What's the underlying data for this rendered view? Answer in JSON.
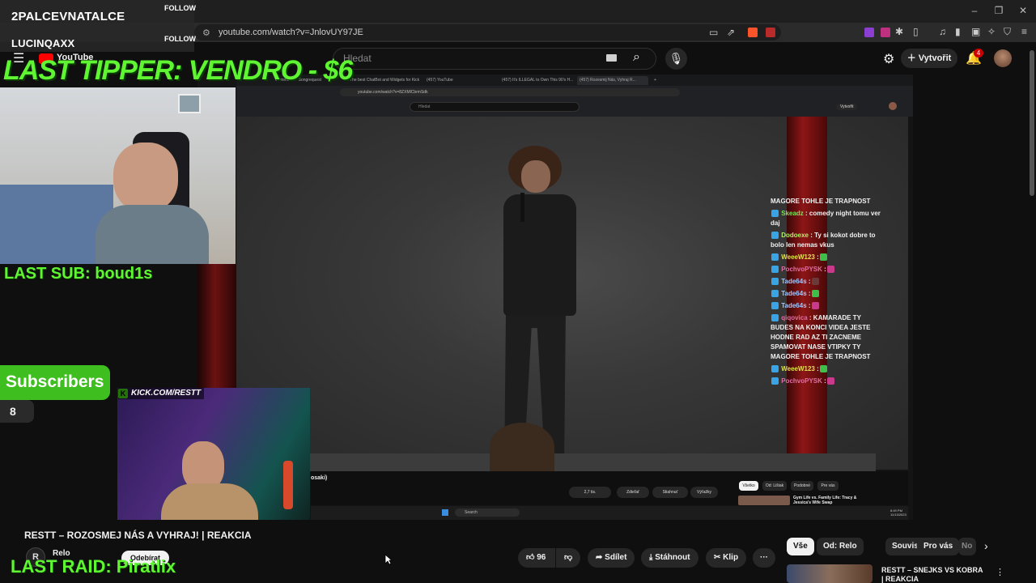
{
  "browser": {
    "url": "youtube.com/watch?v=JnlovUY97JE",
    "window_controls": [
      "–",
      "❐",
      "✕"
    ]
  },
  "youtube": {
    "logo_text": "YouTube",
    "search_placeholder": "Hledat",
    "create_label": "Vytvořit",
    "notifications_count": "4"
  },
  "overlays": {
    "recent_follows": [
      {
        "name": "2PALCEVNATALCE",
        "tag": "FOLLOW"
      },
      {
        "name": "LUCINQAXX",
        "tag": "FOLLOW"
      }
    ],
    "last_tipper": "LAST TIPPER: VENDRO - $6",
    "last_sub": "LAST SUB: boud1s",
    "subscribers_label": "Subscribers",
    "subscribers_count": "8",
    "last_raid": "LAST RAID: Piratlix",
    "kick_badge": "KICK.COM/RESTT"
  },
  "inner_video": {
    "tabs": [
      "Comments - Songrequest",
      "The best ChatBot and Widgets for Kick",
      "(457) YouTube",
      "(457) It's ILLEGAL to Own This 90's H...",
      "(457) Rozesmij Nás, Vyhraj R...",
      "+"
    ],
    "url": "youtube.com/watch?v=8ZXMlCbrmSdk",
    "search_placeholder": "Hledat",
    "create_label": "Vytvořit",
    "partial_title": "osaki)",
    "buttons": {
      "likes": "2,7 tis.",
      "share": "Zdieľať",
      "download": "Stiahnuť",
      "remix": "Výťažky"
    },
    "chips": [
      "Všetko",
      "Od: Lišiak",
      "Podobné",
      "Pre vás"
    ],
    "rec_title": "Gym Life vs. Family Life: Tracy & Jessica's Wife Swap",
    "taskbar_search": "Search",
    "clock": "8:49 PM",
    "date": "11/13/2023"
  },
  "chat": [
    {
      "user": "",
      "text": "MAGORE TOHLE JE TRAPNOST",
      "color": "#f1f1f1"
    },
    {
      "user": "Skeadz",
      "text": ": comedy night tomu ver daj",
      "color": "#7ee35a"
    },
    {
      "user": "Dodoexe",
      "text": ": Ty si kokot dobre to bolo len nemas vkus",
      "color": "#b5f06a"
    },
    {
      "user": "WeeeW123",
      "text": ":",
      "color": "#dfe34a"
    },
    {
      "user": "PochvoPYSK",
      "text": ":",
      "color": "#e06fa4"
    },
    {
      "user": "Tade64s",
      "text": ":",
      "color": "#9fc7ff"
    },
    {
      "user": "Tade64s",
      "text": ":",
      "color": "#9fc7ff"
    },
    {
      "user": "Tade64s",
      "text": ":",
      "color": "#9fc7ff"
    },
    {
      "user": "qiqovica",
      "text": ": KAMARADE TY BUDES NA KONCI VIDEA JESTE HODNE RAD AZ TI ZACNEME SPAMOVAT NASE VTIPKY TY MAGORE TOHLE JE TRAPNOST",
      "color": "#e06fa4"
    },
    {
      "user": "WeeeW123",
      "text": ":",
      "color": "#dfe34a"
    },
    {
      "user": "PochvoPYSK",
      "text": ":",
      "color": "#e06fa4"
    }
  ],
  "video": {
    "title": "RESTT – ROZOSMEJ NÁS A VYHRAJ! | REAKCIA",
    "channel": "Relo",
    "subscribe_label": "Odebírat",
    "like_count": "96",
    "share_label": "Sdílet",
    "download_label": "Stáhnout",
    "clip_label": "Klip",
    "more_label": "···"
  },
  "sidebar": {
    "chips": [
      "Vše",
      "Od: Relo",
      "Související",
      "Pro vás",
      "No"
    ],
    "next_video_title": "RESTT – SNEJKS VS KOBRA | REAKCIA"
  }
}
